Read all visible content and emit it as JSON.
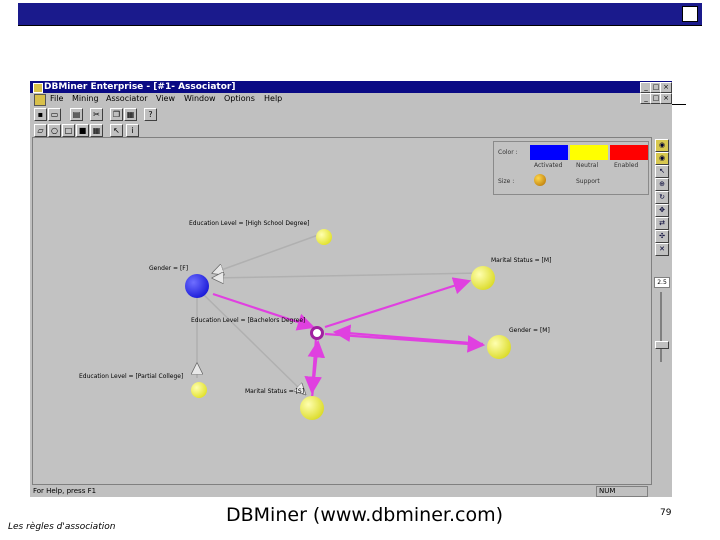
{
  "window": {
    "title": "DBMiner Enterprise - [#1- Associator]",
    "controls": [
      "_",
      "□",
      "×"
    ],
    "inner_controls": [
      "_",
      "□",
      "×"
    ]
  },
  "menu": [
    "File",
    "Mining",
    "Associator",
    "View",
    "Window",
    "Options",
    "Help"
  ],
  "legend": {
    "color_label": "Color :",
    "size_label": "Size :",
    "activated": "Activated",
    "neutral": "Neutral",
    "enabled": "Enabled",
    "support": "Support",
    "colors": {
      "activated": "#0000ff",
      "neutral": "#ffff00",
      "enabled": "#ff0000"
    }
  },
  "graph": {
    "nodes": [
      {
        "label": "Education Level = [High School Degree]",
        "color": "#e8e800"
      },
      {
        "label": "Gender = [F]",
        "color": "#1010ee"
      },
      {
        "label": "Marital Status = [M]",
        "color": "#e8e800"
      },
      {
        "label": "Education Level = [Bachelors Degree]",
        "color": "#ffffff"
      },
      {
        "label": "Gender = [M]",
        "color": "#e8e800"
      },
      {
        "label": "Education Level = [Partial College]",
        "color": "#e8e800"
      },
      {
        "label": "Marital Status = [S]",
        "color": "#e8e800"
      }
    ],
    "edge_colors": {
      "active": "#e040e0",
      "inactive": "#b0b0b0"
    }
  },
  "zoom": "2.5",
  "status": {
    "help": "For Help, press F1",
    "num": "NUM"
  },
  "slide": {
    "footer_left": "Les règles d'association",
    "caption": "DBMiner (www.dbminer.com)",
    "page_number": "79"
  }
}
